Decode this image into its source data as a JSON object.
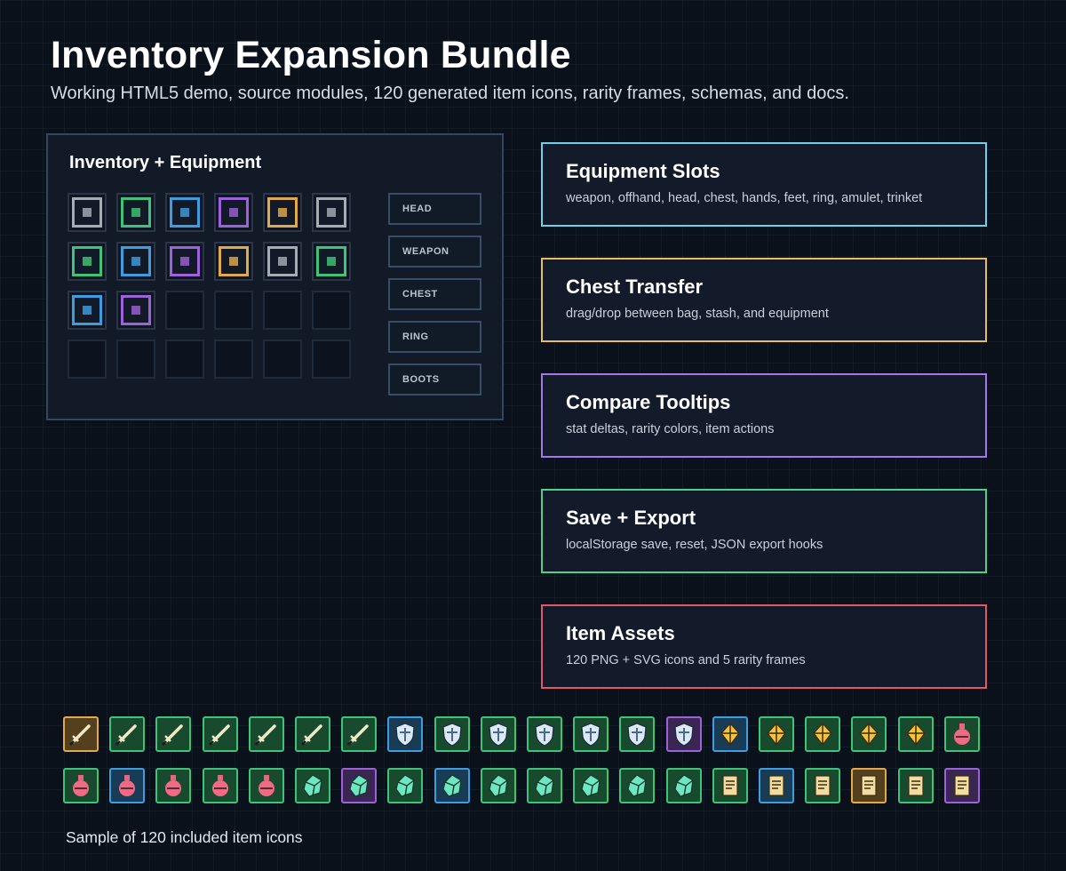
{
  "header": {
    "title": "Inventory Expansion Bundle",
    "subtitle": "Working HTML5 demo, source modules, 120 generated item icons, rarity frames, schemas, and docs."
  },
  "colors": {
    "common": "#a4acb6",
    "uncommon": "#3fc27a",
    "rare": "#3e9de0",
    "epic": "#9b62d9",
    "legendary": "#e0a94e",
    "mythic": "#e0566a"
  },
  "inventory": {
    "title": "Inventory + Equipment",
    "slots": [
      [
        "common",
        "uncommon",
        "rare",
        "epic",
        "legendary",
        "common"
      ],
      [
        "uncommon",
        "rare",
        "epic",
        "legendary",
        "common",
        "uncommon"
      ],
      [
        "rare",
        "epic",
        "",
        "",
        "",
        ""
      ],
      [
        "",
        "",
        "",
        "",
        "",
        ""
      ]
    ],
    "equipment": [
      "HEAD",
      "WEAPON",
      "CHEST",
      "RING",
      "BOOTS"
    ]
  },
  "features": [
    {
      "title": "Equipment Slots",
      "desc": "weapon, offhand, head, chest, hands, feet, ring, amulet, trinket",
      "color": "#6fd0ea"
    },
    {
      "title": "Chest Transfer",
      "desc": "drag/drop between bag, stash, and equipment",
      "color": "#e8be5c"
    },
    {
      "title": "Compare Tooltips",
      "desc": "stat deltas, rarity colors, item actions",
      "color": "#a577e8"
    },
    {
      "title": "Save + Export",
      "desc": "localStorage save, reset, JSON export hooks",
      "color": "#4fd08d"
    },
    {
      "title": "Item Assets",
      "desc": "120 PNG + SVG icons and 5 rarity frames",
      "color": "#e0566a"
    }
  ],
  "icons": {
    "row1": [
      {
        "type": "sword-icon",
        "rarity": "legendary"
      },
      {
        "type": "sword-icon",
        "rarity": "uncommon"
      },
      {
        "type": "sword-icon",
        "rarity": "uncommon"
      },
      {
        "type": "sword-icon",
        "rarity": "uncommon"
      },
      {
        "type": "sword-icon",
        "rarity": "uncommon"
      },
      {
        "type": "sword-icon",
        "rarity": "uncommon"
      },
      {
        "type": "sword-icon",
        "rarity": "uncommon"
      },
      {
        "type": "shield-icon",
        "rarity": "rare"
      },
      {
        "type": "shield-icon",
        "rarity": "uncommon"
      },
      {
        "type": "shield-icon",
        "rarity": "uncommon"
      },
      {
        "type": "shield-icon",
        "rarity": "uncommon"
      },
      {
        "type": "shield-icon",
        "rarity": "uncommon"
      },
      {
        "type": "shield-icon",
        "rarity": "uncommon"
      },
      {
        "type": "shield-icon",
        "rarity": "epic"
      },
      {
        "type": "amulet-icon",
        "rarity": "rare"
      },
      {
        "type": "amulet-icon",
        "rarity": "uncommon"
      },
      {
        "type": "amulet-icon",
        "rarity": "uncommon"
      },
      {
        "type": "amulet-icon",
        "rarity": "uncommon"
      },
      {
        "type": "amulet-icon",
        "rarity": "uncommon"
      },
      {
        "type": "potion-icon",
        "rarity": "uncommon"
      }
    ],
    "row2": [
      {
        "type": "potion-icon",
        "rarity": "uncommon"
      },
      {
        "type": "potion-icon",
        "rarity": "rare"
      },
      {
        "type": "potion-icon",
        "rarity": "uncommon"
      },
      {
        "type": "potion-icon",
        "rarity": "uncommon"
      },
      {
        "type": "potion-icon",
        "rarity": "uncommon"
      },
      {
        "type": "crystal-icon",
        "rarity": "uncommon"
      },
      {
        "type": "crystal-icon",
        "rarity": "epic"
      },
      {
        "type": "crystal-icon",
        "rarity": "uncommon"
      },
      {
        "type": "crystal-icon",
        "rarity": "rare"
      },
      {
        "type": "crystal-icon",
        "rarity": "uncommon"
      },
      {
        "type": "crystal-icon",
        "rarity": "uncommon"
      },
      {
        "type": "crystal-icon",
        "rarity": "uncommon"
      },
      {
        "type": "crystal-icon",
        "rarity": "uncommon"
      },
      {
        "type": "crystal-icon",
        "rarity": "uncommon"
      },
      {
        "type": "scroll-icon",
        "rarity": "uncommon"
      },
      {
        "type": "scroll-icon",
        "rarity": "rare"
      },
      {
        "type": "scroll-icon",
        "rarity": "uncommon"
      },
      {
        "type": "scroll-icon",
        "rarity": "legendary"
      },
      {
        "type": "scroll-icon",
        "rarity": "uncommon"
      },
      {
        "type": "scroll-icon",
        "rarity": "epic"
      }
    ],
    "caption": "Sample of 120 included item icons"
  }
}
